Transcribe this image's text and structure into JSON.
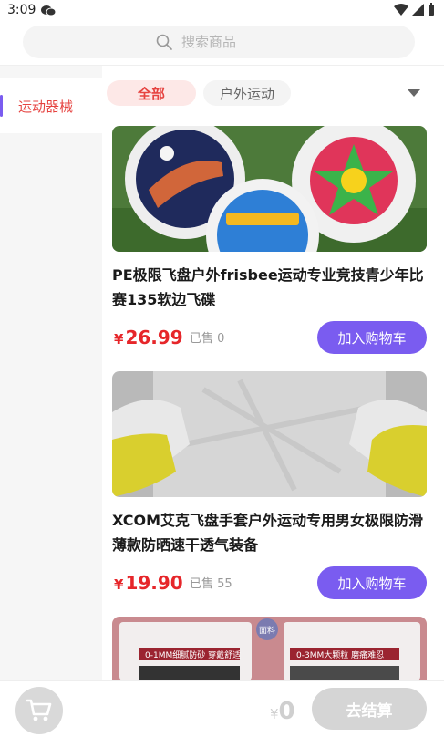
{
  "status": {
    "time": "3:09"
  },
  "search": {
    "placeholder": "搜索商品"
  },
  "sidebar": {
    "items": [
      {
        "label": "运动器械"
      }
    ]
  },
  "filters": {
    "chips": [
      {
        "label": "全部"
      },
      {
        "label": "户外运动"
      }
    ]
  },
  "products": [
    {
      "title": "PE极限飞盘户外frisbee运动专业竞技青少年比赛135软边飞碟",
      "price": "26.99",
      "currency": "¥",
      "sold": "已售 0",
      "button": "加入购物车"
    },
    {
      "title": "XCOM艾克飞盘手套户外运动专用男女极限防滑薄款防晒速干透气装备",
      "price": "19.90",
      "currency": "¥",
      "sold": "已售 55",
      "button": "加入购物车"
    }
  ],
  "third_product_image_texts": [
    "0-1MM细腻防砂 穿戴舒适",
    "0-3MM大颗粒 磨痛难忍",
    "面料"
  ],
  "bottom": {
    "currency": "¥",
    "total": "0",
    "checkout_label": "去结算"
  },
  "colors": {
    "accent": "#7a5cf0",
    "price": "#e6262a",
    "active": "#e64340"
  }
}
